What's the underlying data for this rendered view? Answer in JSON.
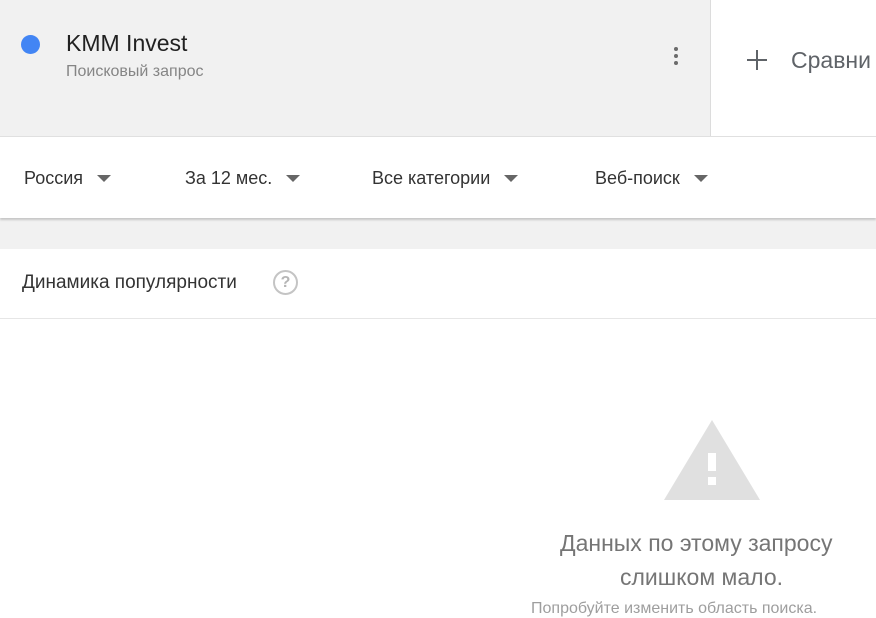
{
  "term": {
    "title": "KMM Invest",
    "subtitle": "Поисковый запрос",
    "dot_color": "#4285f4",
    "menu_icon": "more-vert-icon"
  },
  "compare": {
    "icon": "plus-icon",
    "label": "Сравни"
  },
  "filters": [
    {
      "label": "Россия"
    },
    {
      "label": "За 12 мес."
    },
    {
      "label": "Все категории"
    },
    {
      "label": "Веб-поиск"
    }
  ],
  "section": {
    "title": "Динамика популярности",
    "help_glyph": "?"
  },
  "empty_state": {
    "icon": "warning-icon",
    "line1": "Данных по этому запросу",
    "line2": "слишком мало.",
    "line3": "Попробуйте изменить область поиска."
  },
  "colors": {
    "accent": "#4285f4",
    "panel_bg": "#f1f1f1",
    "warning_icon": "#e0e0e0"
  }
}
